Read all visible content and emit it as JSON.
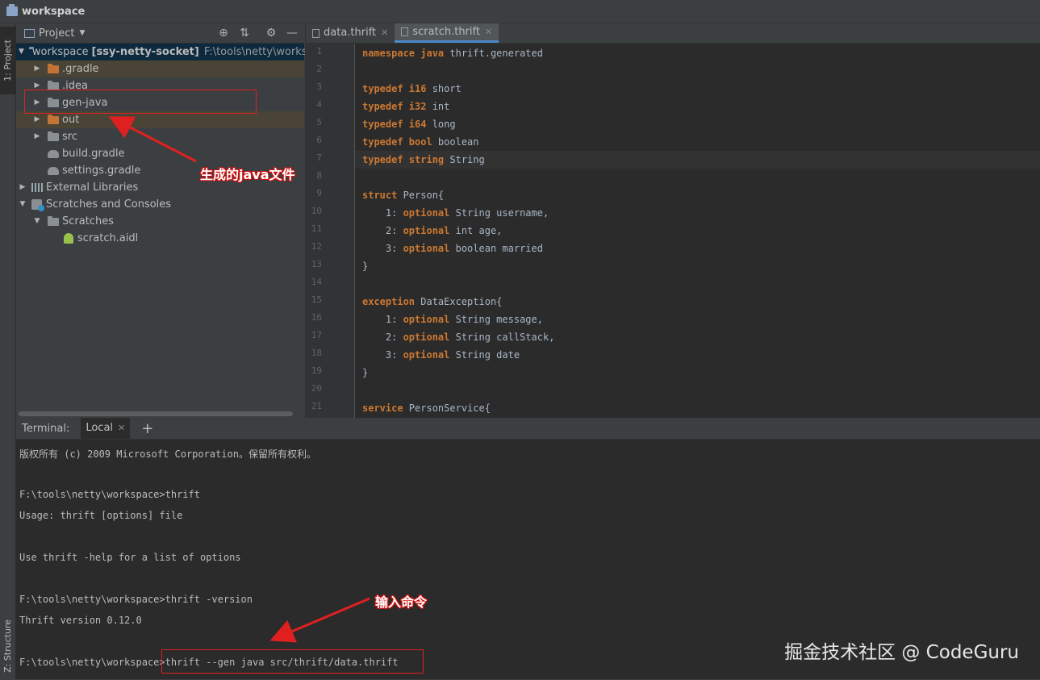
{
  "title_bar": {
    "title": "workspace"
  },
  "left_strip": {
    "project_tab": "1: Project",
    "structure_tab": "Z: Structure"
  },
  "project_panel": {
    "header": "Project",
    "rows": [
      {
        "label": "workspace",
        "module": "[ssy-netty-socket]",
        "path": "F:\\tools\\netty\\workspace"
      },
      {
        "label": ".gradle"
      },
      {
        "label": ".idea"
      },
      {
        "label": "gen-java"
      },
      {
        "label": "out"
      },
      {
        "label": "src"
      },
      {
        "label": "build.gradle"
      },
      {
        "label": "settings.gradle"
      },
      {
        "label": "External Libraries"
      },
      {
        "label": "Scratches and Consoles"
      },
      {
        "label": "Scratches"
      },
      {
        "label": "scratch.aidl"
      }
    ]
  },
  "editor": {
    "tabs": [
      {
        "label": "data.thrift"
      },
      {
        "label": "scratch.thrift"
      }
    ],
    "line_numbers": [
      "1",
      "2",
      "3",
      "4",
      "5",
      "6",
      "7",
      "8",
      "9",
      "10",
      "11",
      "12",
      "13",
      "14",
      "15",
      "16",
      "17",
      "18",
      "19",
      "20",
      "21"
    ],
    "lines": [
      {
        "kw": "namespace java",
        "rest": " thrift.generated"
      },
      {
        "kw": "",
        "rest": ""
      },
      {
        "kw": "typedef i16",
        "rest": " short"
      },
      {
        "kw": "typedef i32",
        "rest": " int"
      },
      {
        "kw": "typedef i64",
        "rest": " long"
      },
      {
        "kw": "typedef bool",
        "rest": " boolean"
      },
      {
        "kw": "typedef string",
        "rest": " String"
      },
      {
        "kw": "",
        "rest": ""
      },
      {
        "kw": "struct",
        "rest": " Person{"
      },
      {
        "pre": "    1: ",
        "kw": "optional",
        "rest": " String username,"
      },
      {
        "pre": "    2: ",
        "kw": "optional",
        "rest": " int age,"
      },
      {
        "pre": "    3: ",
        "kw": "optional",
        "rest": " boolean married"
      },
      {
        "kw": "",
        "rest": "}"
      },
      {
        "kw": "",
        "rest": ""
      },
      {
        "kw": "exception",
        "rest": " DataException{"
      },
      {
        "pre": "    1: ",
        "kw": "optional",
        "rest": " String message,"
      },
      {
        "pre": "    2: ",
        "kw": "optional",
        "rest": " String callStack,"
      },
      {
        "pre": "    3: ",
        "kw": "optional",
        "rest": " String date"
      },
      {
        "kw": "",
        "rest": "}"
      },
      {
        "kw": "",
        "rest": ""
      },
      {
        "kw": "service",
        "rest": " PersonService{"
      }
    ]
  },
  "terminal": {
    "label": "Terminal:",
    "tab": "Local",
    "add": "+",
    "lines": [
      "版权所有 (c) 2009 Microsoft Corporation。保留所有权利。",
      "",
      "F:\\tools\\netty\\workspace>thrift",
      "Usage: thrift [options] file",
      "",
      "Use thrift -help for a list of options",
      "",
      "F:\\tools\\netty\\workspace>thrift -version",
      "Thrift version 0.12.0",
      "",
      "F:\\tools\\netty\\workspace>thrift --gen java src/thrift/data.thrift"
    ]
  },
  "annotations": {
    "generated": "生成的java文件",
    "command": "输入命令"
  },
  "watermark": "掘金技术社区 @ CodeGuru",
  "colors": {
    "keyword": "#cc7832",
    "annotation_red": "#e02020",
    "selection": "#0d293e"
  }
}
